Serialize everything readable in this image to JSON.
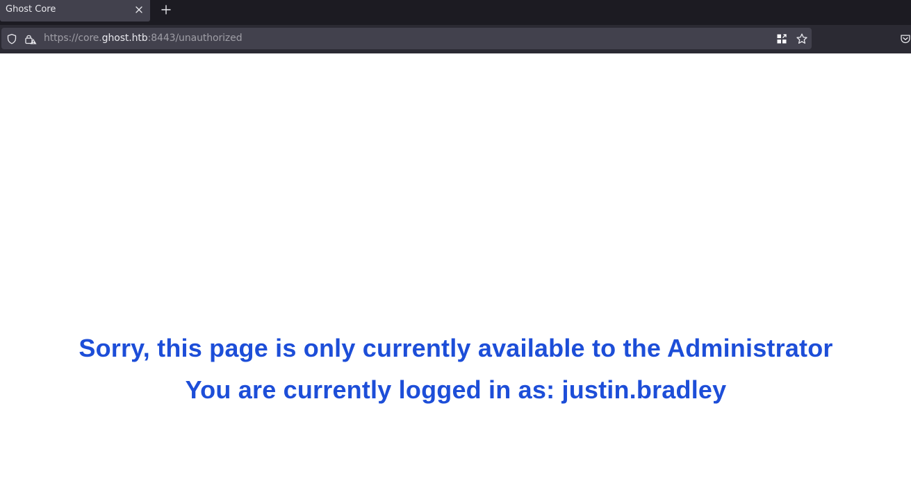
{
  "tab": {
    "title": "Ghost Core"
  },
  "urlbar": {
    "url_prefix": "https://core.",
    "url_host": "ghost.htb",
    "url_suffix": ":8443/unauthorized"
  },
  "page": {
    "message_line1": "Sorry, this page is only currently available to the Administrator",
    "message_line2": "You are currently logged in as: justin.bradley"
  },
  "colors": {
    "accent": "#1d4ed8",
    "chrome_bg": "#2b2a33",
    "tabbar_bg": "#1c1b22",
    "active_tab_bg": "#42414d"
  },
  "icons": [
    "close-icon",
    "plus-icon",
    "shield-icon",
    "lock-warning-icon",
    "qr-code-icon",
    "star-icon",
    "pocket-icon"
  ]
}
